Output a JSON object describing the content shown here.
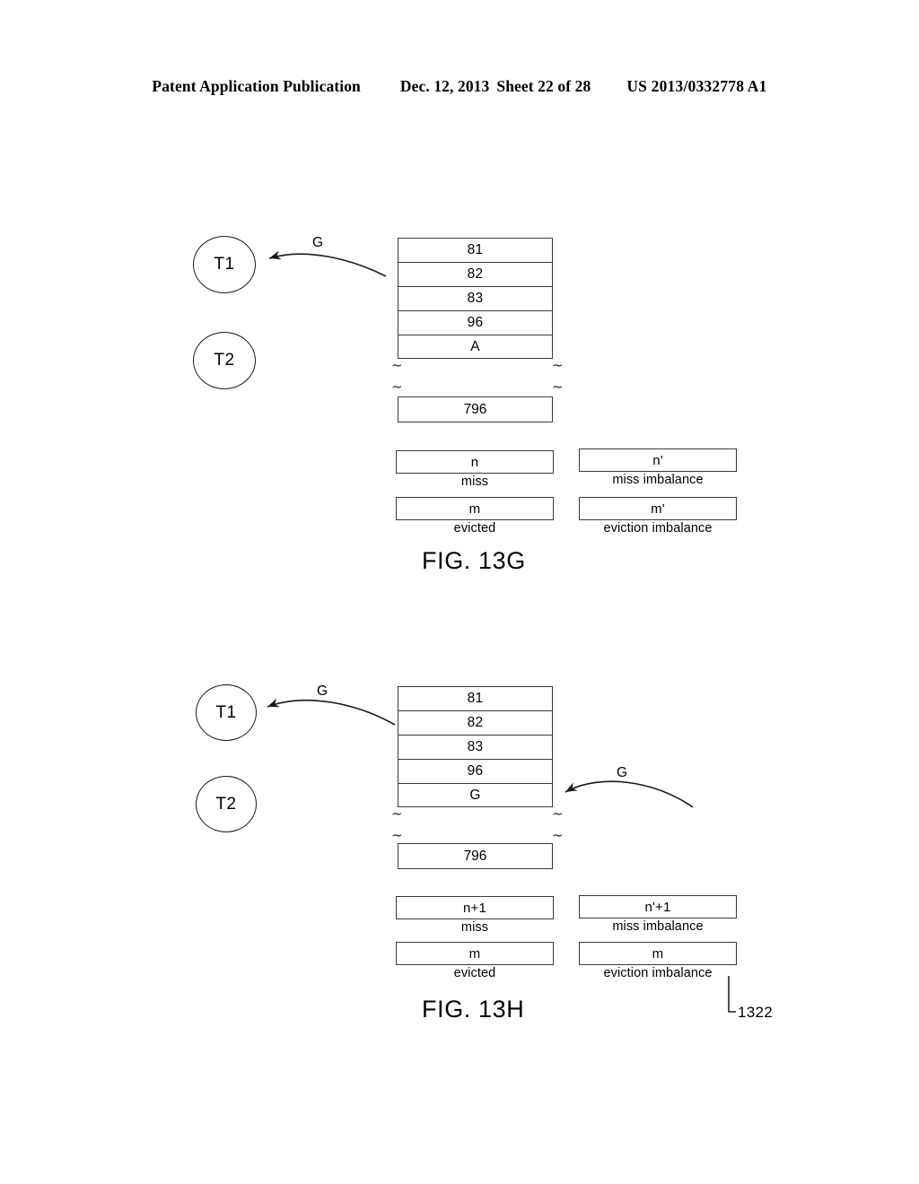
{
  "header": {
    "title": "Patent Application Publication",
    "date": "Dec. 12, 2013",
    "sheet": "Sheet 22 of 28",
    "publication_number": "US 2013/0332778 A1"
  },
  "figures": [
    {
      "id": "13g",
      "caption": "FIG. 13G",
      "threads": [
        {
          "label": "T1"
        },
        {
          "label": "T2"
        }
      ],
      "stack": {
        "rows": [
          "81",
          "82",
          "83",
          "96",
          "A"
        ],
        "tail": "796",
        "break_mark": "~"
      },
      "arrows": [
        {
          "name": "eviction-arrow-to-t1",
          "label": "G"
        }
      ],
      "counters": [
        {
          "value": "n",
          "caption": "miss"
        },
        {
          "value": "n'",
          "caption": "miss imbalance"
        },
        {
          "value": "m",
          "caption": "evicted"
        },
        {
          "value": "m'",
          "caption": "eviction imbalance"
        }
      ]
    },
    {
      "id": "13h",
      "caption": "FIG. 13H",
      "threads": [
        {
          "label": "T1"
        },
        {
          "label": "T2"
        }
      ],
      "stack": {
        "rows": [
          "81",
          "82",
          "83",
          "96",
          "G"
        ],
        "tail": "796",
        "break_mark": "~"
      },
      "arrows": [
        {
          "name": "eviction-arrow-to-t1",
          "label": "G"
        },
        {
          "name": "insertion-arrow-to-stack",
          "label": "G"
        }
      ],
      "counters": [
        {
          "value": "n+1",
          "caption": "miss"
        },
        {
          "value": "n'+1",
          "caption": "miss imbalance"
        },
        {
          "value": "m",
          "caption": "evicted"
        },
        {
          "value": "m",
          "caption": "eviction imbalance"
        }
      ],
      "reference_number": "1322"
    }
  ],
  "colors": {
    "ink": "#000000",
    "line": "#3a3a3a",
    "background": "#ffffff"
  }
}
